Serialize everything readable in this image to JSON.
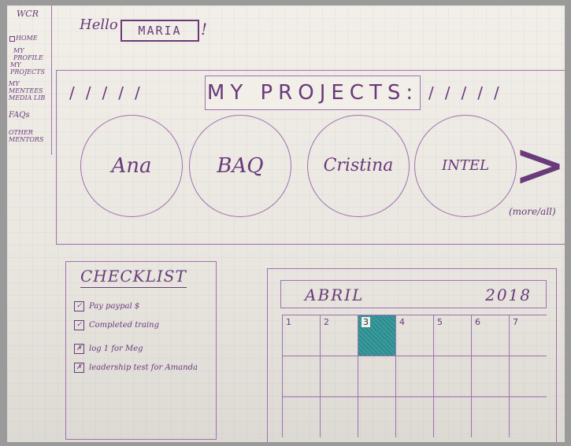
{
  "sidebar": {
    "brand": "WCR",
    "items": [
      {
        "label": "HOME",
        "icon": "home-icon"
      },
      {
        "label": "MY PROFILE"
      },
      {
        "label": "MY PROJECTS"
      },
      {
        "label": "MY MENTEES"
      },
      {
        "label": "MEDIA LIB"
      },
      {
        "label": "FAQs"
      },
      {
        "label": "OTHER\nMENTORS"
      }
    ]
  },
  "greeting": {
    "hello": "Hello",
    "name": "MARIA",
    "exclaim": "!"
  },
  "projects": {
    "title": "MY PROJECTS:",
    "items": [
      {
        "label": "Ana"
      },
      {
        "label": "BAQ"
      },
      {
        "label": "Cristina"
      },
      {
        "label": "INTEL"
      }
    ],
    "next_icon": "chevron-right-icon",
    "more_label": "(more/all)"
  },
  "checklist": {
    "title": "CHECKLIST",
    "items": [
      {
        "mark": "✓",
        "label": "Pay paypal $"
      },
      {
        "mark": "✓",
        "label": "Completed traing"
      },
      {
        "mark": "✗",
        "label": "log 1 for Meg"
      },
      {
        "mark": "✗",
        "label": "leadership test for Amanda"
      }
    ]
  },
  "calendar": {
    "month": "ABRIL",
    "year": "2018",
    "days": [
      "1",
      "2",
      "3",
      "4",
      "5",
      "6",
      "7"
    ],
    "highlight_day": "3",
    "highlight_color": "#3a9c9e"
  }
}
